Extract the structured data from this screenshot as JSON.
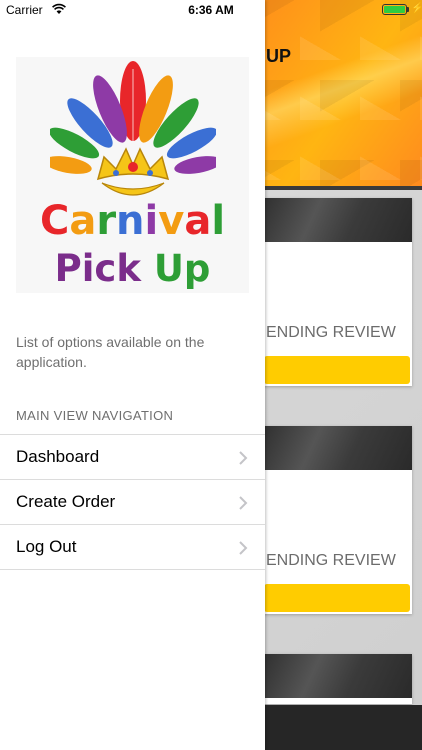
{
  "status_bar": {
    "carrier": "Carrier",
    "time": "6:36 AM",
    "wifi_icon": "wifi-icon",
    "battery_icon": "battery-icon",
    "charging_icon": "charging-bolt-icon"
  },
  "background_screen": {
    "header_title_fragment": "UP",
    "cards": [
      {
        "status": "ENDING REVIEW"
      },
      {
        "status": "ENDING REVIEW"
      },
      {
        "status": ""
      }
    ],
    "colors": {
      "header": "#ff8a1e",
      "button": "#ffcc00",
      "card_top": "#3b3b3b",
      "tab_bar": "#262626"
    }
  },
  "drawer": {
    "logo": {
      "line1": "Carnival",
      "line2": "Pick Up",
      "line1_colors": [
        "#e8262a",
        "#f39c12",
        "#2e9e36",
        "#3b6fd4",
        "#8e3aa6",
        "#f39c12",
        "#e8262a",
        "#2e9e36"
      ],
      "line2_colors": [
        "#7b2d8b",
        "#7b2d8b",
        "#7b2d8b",
        "#7b2d8b",
        "#ffffff",
        "#2e9e36",
        "#2e9e36"
      ],
      "icon": "carnival-feather-headdress-icon"
    },
    "description": "List of options available on the application.",
    "section_label": "MAIN VIEW NAVIGATION",
    "menu_items": [
      {
        "label": "Dashboard",
        "icon": "chevron-right-icon"
      },
      {
        "label": "Create Order",
        "icon": "chevron-right-icon"
      },
      {
        "label": "Log Out",
        "icon": "chevron-right-icon"
      }
    ]
  }
}
